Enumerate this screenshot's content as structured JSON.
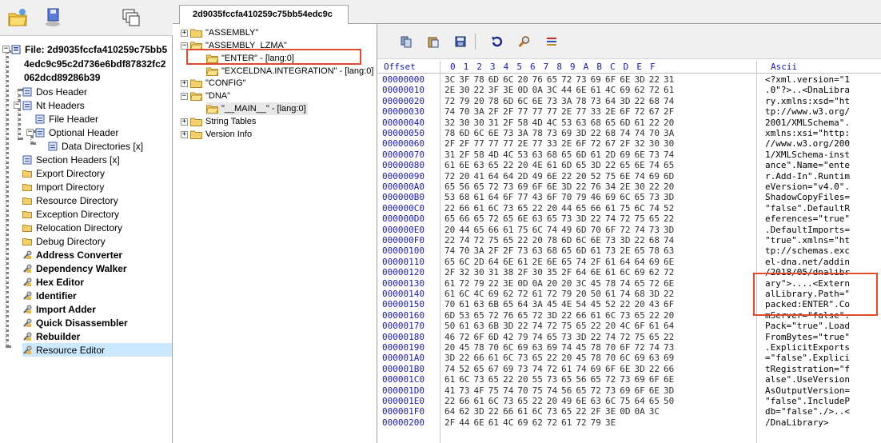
{
  "tab": {
    "label": "2d9035fccfa410259c75bb54edc9c"
  },
  "left_tree": {
    "file_label_lines": [
      "File: 2d9035fccfa410259c75bb5",
      "4edc9c95c2d736e6bdf87832fc2",
      "062dcd89286b39"
    ],
    "items": [
      {
        "label": "Dos Header"
      },
      {
        "label": "Nt Headers"
      },
      {
        "label": "File Header"
      },
      {
        "label": "Optional Header"
      },
      {
        "label": "Data Directories [x]"
      },
      {
        "label": "Section Headers [x]"
      },
      {
        "label": "Export Directory"
      },
      {
        "label": "Import Directory"
      },
      {
        "label": "Resource Directory"
      },
      {
        "label": "Exception Directory"
      },
      {
        "label": "Relocation Directory"
      },
      {
        "label": "Debug Directory"
      },
      {
        "label": "Address Converter"
      },
      {
        "label": "Dependency Walker"
      },
      {
        "label": "Hex Editor"
      },
      {
        "label": "Identifier"
      },
      {
        "label": "Import Adder"
      },
      {
        "label": "Quick Disassembler"
      },
      {
        "label": "Rebuilder"
      },
      {
        "label": "Resource Editor"
      }
    ]
  },
  "resource_tree": {
    "items": [
      {
        "label": "\"ASSEMBLY\""
      },
      {
        "label": "\"ASSEMBLY_LZMA\""
      },
      {
        "label": "\"ENTER\" - [lang:0]"
      },
      {
        "label": "\"EXCELDNA.INTEGRATION\" - [lang:0]"
      },
      {
        "label": "\"CONFIG\""
      },
      {
        "label": "\"DNA\""
      },
      {
        "label": "\"__MAIN__\" - [lang:0]"
      },
      {
        "label": "String Tables"
      },
      {
        "label": "Version Info"
      }
    ]
  },
  "hex": {
    "header_offset": "Offset",
    "header_cols": "0  1  2  3  4  5  6  7  8  9  A  B  C  D  E  F",
    "header_ascii": "Ascii",
    "rows": [
      {
        "off": "00000000",
        "hex": "3C 3F 78 6D 6C 20 76 65 72 73 69 6F 6E 3D 22 31",
        "asc": "<?xml.version=\"1"
      },
      {
        "off": "00000010",
        "hex": "2E 30 22 3F 3E 0D 0A 3C 44 6E 61 4C 69 62 72 61",
        "asc": ".0\"?>..<DnaLibra"
      },
      {
        "off": "00000020",
        "hex": "72 79 20 78 6D 6C 6E 73 3A 78 73 64 3D 22 68 74",
        "asc": "ry.xmlns:xsd=\"ht"
      },
      {
        "off": "00000030",
        "hex": "74 70 3A 2F 2F 77 77 77 2E 77 33 2E 6F 72 67 2F",
        "asc": "tp://www.w3.org/"
      },
      {
        "off": "00000040",
        "hex": "32 30 30 31 2F 58 4D 4C 53 63 68 65 6D 61 22 20",
        "asc": "2001/XMLSchema\"."
      },
      {
        "off": "00000050",
        "hex": "78 6D 6C 6E 73 3A 78 73 69 3D 22 68 74 74 70 3A",
        "asc": "xmlns:xsi=\"http:"
      },
      {
        "off": "00000060",
        "hex": "2F 2F 77 77 77 2E 77 33 2E 6F 72 67 2F 32 30 30",
        "asc": "//www.w3.org/200"
      },
      {
        "off": "00000070",
        "hex": "31 2F 58 4D 4C 53 63 68 65 6D 61 2D 69 6E 73 74",
        "asc": "1/XMLSchema-inst"
      },
      {
        "off": "00000080",
        "hex": "61 6E 63 65 22 20 4E 61 6D 65 3D 22 65 6E 74 65",
        "asc": "ance\".Name=\"ente"
      },
      {
        "off": "00000090",
        "hex": "72 20 41 64 64 2D 49 6E 22 20 52 75 6E 74 69 6D",
        "asc": "r.Add-In\".Runtim"
      },
      {
        "off": "000000A0",
        "hex": "65 56 65 72 73 69 6F 6E 3D 22 76 34 2E 30 22 20",
        "asc": "eVersion=\"v4.0\"."
      },
      {
        "off": "000000B0",
        "hex": "53 68 61 64 6F 77 43 6F 70 79 46 69 6C 65 73 3D",
        "asc": "ShadowCopyFiles="
      },
      {
        "off": "000000C0",
        "hex": "22 66 61 6C 73 65 22 20 44 65 66 61 75 6C 74 52",
        "asc": "\"false\".DefaultR"
      },
      {
        "off": "000000D0",
        "hex": "65 66 65 72 65 6E 63 65 73 3D 22 74 72 75 65 22",
        "asc": "eferences=\"true\""
      },
      {
        "off": "000000E0",
        "hex": "20 44 65 66 61 75 6C 74 49 6D 70 6F 72 74 73 3D",
        "asc": ".DefaultImports="
      },
      {
        "off": "000000F0",
        "hex": "22 74 72 75 65 22 20 78 6D 6C 6E 73 3D 22 68 74",
        "asc": "\"true\".xmlns=\"ht"
      },
      {
        "off": "00000100",
        "hex": "74 70 3A 2F 2F 73 63 68 65 6D 61 73 2E 65 78 63",
        "asc": "tp://schemas.exc"
      },
      {
        "off": "00000110",
        "hex": "65 6C 2D 64 6E 61 2E 6E 65 74 2F 61 64 64 69 6E",
        "asc": "el-dna.net/addin"
      },
      {
        "off": "00000120",
        "hex": "2F 32 30 31 38 2F 30 35 2F 64 6E 61 6C 69 62 72",
        "asc": "/2018/05/dnalibr"
      },
      {
        "off": "00000130",
        "hex": "61 72 79 22 3E 0D 0A 20 20 3C 45 78 74 65 72 6E",
        "asc": "ary\">....<Extern"
      },
      {
        "off": "00000140",
        "hex": "61 6C 4C 69 62 72 61 72 79 20 50 61 74 68 3D 22",
        "asc": "alLibrary.Path=\""
      },
      {
        "off": "00000150",
        "hex": "70 61 63 6B 65 64 3A 45 4E 54 45 52 22 20 43 6F",
        "asc": "packed:ENTER\".Co"
      },
      {
        "off": "00000160",
        "hex": "6D 53 65 72 76 65 72 3D 22 66 61 6C 73 65 22 20",
        "asc": "mServer=\"false\"."
      },
      {
        "off": "00000170",
        "hex": "50 61 63 6B 3D 22 74 72 75 65 22 20 4C 6F 61 64",
        "asc": "Pack=\"true\".Load"
      },
      {
        "off": "00000180",
        "hex": "46 72 6F 6D 42 79 74 65 73 3D 22 74 72 75 65 22",
        "asc": "FromBytes=\"true\""
      },
      {
        "off": "00000190",
        "hex": "20 45 78 70 6C 69 63 69 74 45 78 70 6F 72 74 73",
        "asc": ".ExplicitExports"
      },
      {
        "off": "000001A0",
        "hex": "3D 22 66 61 6C 73 65 22 20 45 78 70 6C 69 63 69",
        "asc": "=\"false\".Explici"
      },
      {
        "off": "000001B0",
        "hex": "74 52 65 67 69 73 74 72 61 74 69 6F 6E 3D 22 66",
        "asc": "tRegistration=\"f"
      },
      {
        "off": "000001C0",
        "hex": "61 6C 73 65 22 20 55 73 65 56 65 72 73 69 6F 6E",
        "asc": "alse\".UseVersion"
      },
      {
        "off": "000001D0",
        "hex": "41 73 4F 75 74 70 75 74 56 65 72 73 69 6F 6E 3D",
        "asc": "AsOutputVersion="
      },
      {
        "off": "000001E0",
        "hex": "22 66 61 6C 73 65 22 20 49 6E 63 6C 75 64 65 50",
        "asc": "\"false\".IncludeP"
      },
      {
        "off": "000001F0",
        "hex": "64 62 3D 22 66 61 6C 73 65 22 2F 3E 0D 0A 3C",
        "asc": "db=\"false\"./>..<"
      },
      {
        "off": "00000200",
        "hex": "2F 44 6E 61 4C 69 62 72 61 72 79 3E",
        "asc": "/DnaLibrary>"
      }
    ]
  },
  "colors": {
    "highlight": "#e04a2f",
    "offset_blue": "#1a1aa8",
    "selection": "#cce8ff"
  }
}
